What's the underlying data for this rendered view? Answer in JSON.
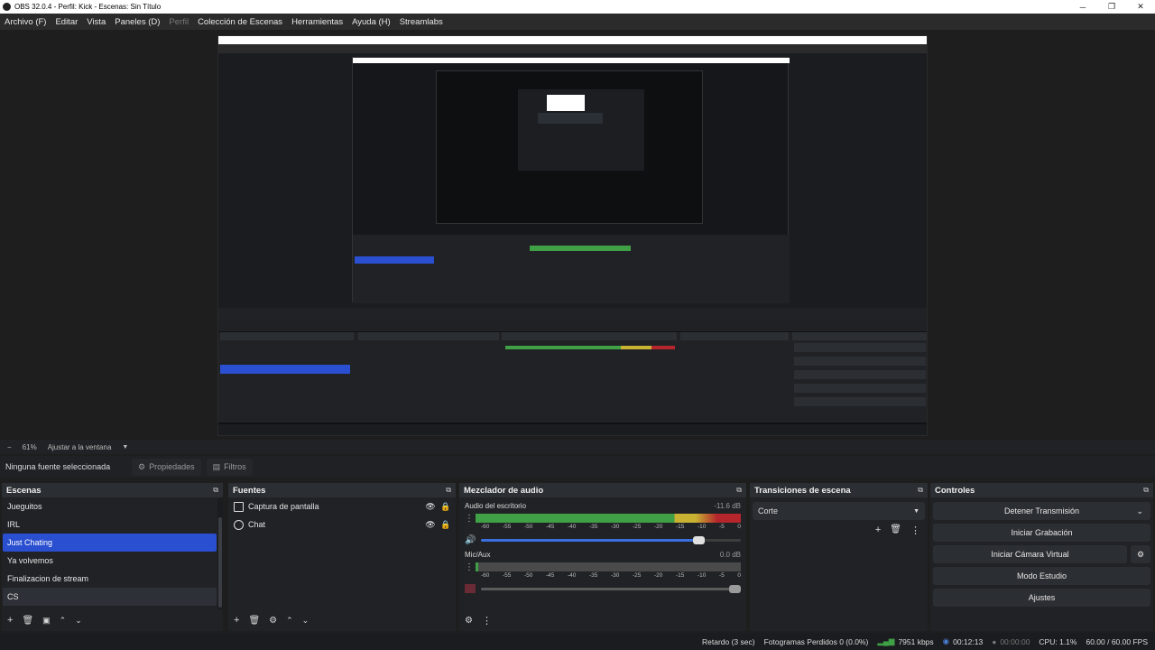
{
  "window": {
    "title": "OBS 32.0.4 - Perfil: Kick - Escenas: Sin Título",
    "minimize": "─",
    "maximize": "❐",
    "close": "✕"
  },
  "menu": [
    "Archivo (F)",
    "Editar",
    "Vista",
    "Paneles (D)",
    "Perfil",
    "Colección de Escenas",
    "Herramientas",
    "Ayuda (H)",
    "Streamlabs"
  ],
  "zoom": {
    "minus": "−",
    "level": "61%",
    "fit_label": "Ajustar a la ventana"
  },
  "context": {
    "source_label": "Ninguna fuente seleccionada",
    "properties": "Propiedades",
    "filters": "Filtros"
  },
  "scenes": {
    "title": "Escenas",
    "items": [
      "Jueguitos",
      "IRL",
      "Just Chating",
      "Ya volvemos",
      "Finalizacion de stream",
      "CS"
    ],
    "selected_index": 2
  },
  "sources": {
    "title": "Fuentes",
    "items": [
      "Captura de pantalla",
      "Chat"
    ]
  },
  "mixer": {
    "title": "Mezclador de audio",
    "channels": [
      {
        "name": "Audio del escritorio",
        "db": "-11.6 dB",
        "level": 0.83,
        "volume": 0.86
      },
      {
        "name": "Mic/Aux",
        "db": "0.0 dB",
        "level": 0.0,
        "volume": 1.0
      }
    ],
    "scale": [
      "-60",
      "-55",
      "-50",
      "-45",
      "-40",
      "-35",
      "-30",
      "-25",
      "-20",
      "-15",
      "-10",
      "-5",
      "0"
    ]
  },
  "transitions": {
    "title": "Transiciones de escena",
    "selected": "Corte"
  },
  "controls": {
    "title": "Controles",
    "stop_stream": "Detener Transmisión",
    "start_recording": "Iniciar Grabación",
    "start_virtual_cam": "Iniciar Cámara Virtual",
    "studio_mode": "Modo Estudio",
    "settings": "Ajustes"
  },
  "status": {
    "delay": "Retardo (3 sec)",
    "dropped": "Fotogramas Perdidos 0 (0.0%)",
    "bitrate": "7951 kbps",
    "stream_time": "00:12:13",
    "rec_time": "00:00:00",
    "cpu": "CPU: 1.1%",
    "fps": "60.00 / 60.00 FPS"
  },
  "colors": {
    "accent": "#2a4fd0",
    "meter_green": "#3fa046",
    "meter_yellow": "#c9b132",
    "meter_red": "#b4262c"
  }
}
